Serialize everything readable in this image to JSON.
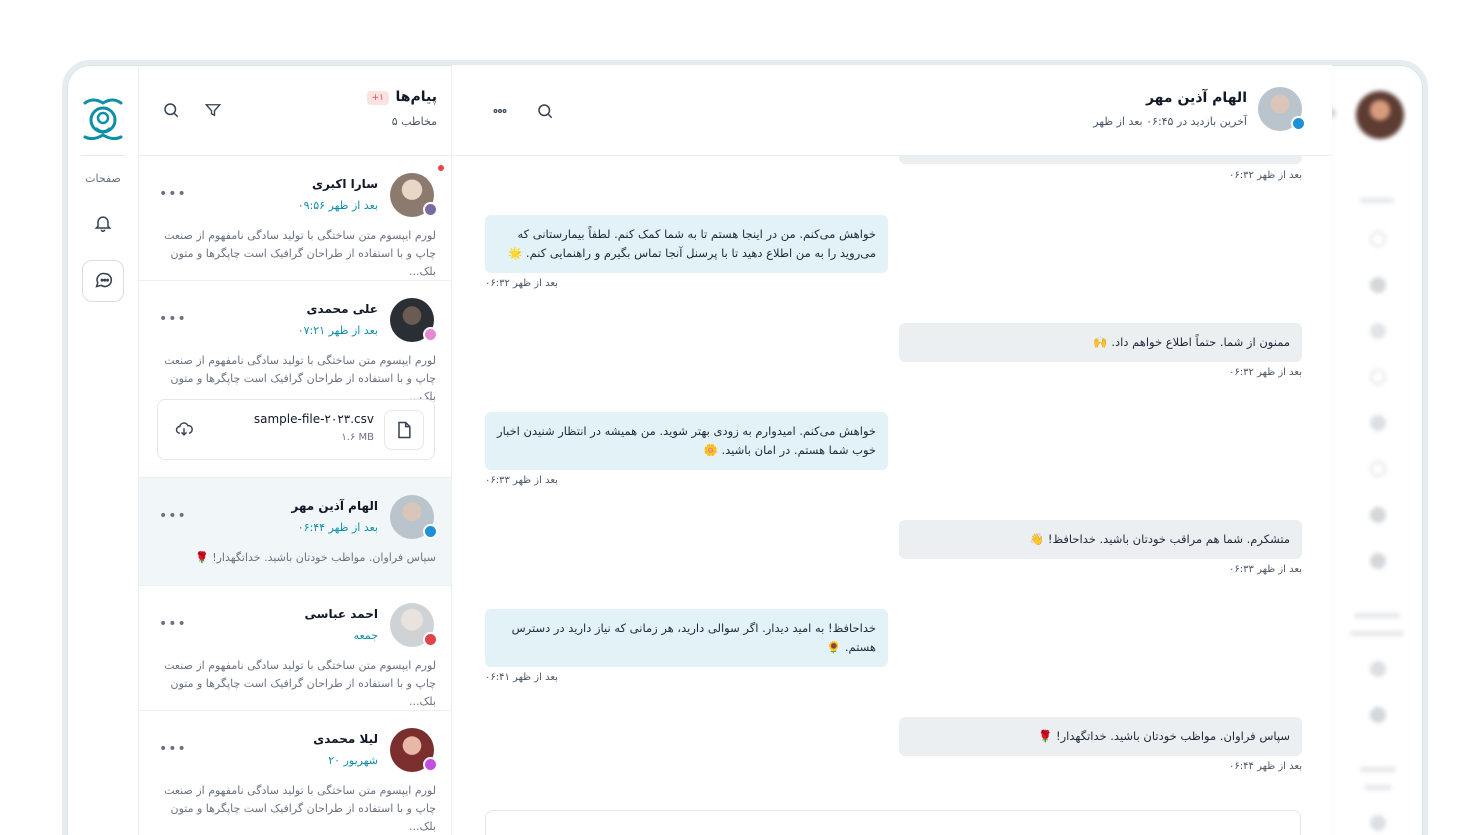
{
  "colors": {
    "accent": "#0e8fa8",
    "bubble_in": "#e3f2f6",
    "bubble_out": "#eceff1",
    "unread": "#ef4444"
  },
  "rail": {
    "pages_label": "صفحات"
  },
  "list": {
    "title": "پیام‌ها",
    "badge": "+۱",
    "subtitle": "۵ مخاطب",
    "conversations": [
      {
        "name": "سارا اکبری",
        "time": "۰۹:۵۶ بعد از ظهر",
        "preview": "لورم ایپسوم متن ساختگی با تولید سادگی نامفهوم از صنعت چاپ و با استفاده از طراحان گرافیک است چاپگرها و متون بلک...",
        "status_color": "#7c6a9e",
        "unread": true
      },
      {
        "name": "علی محمدی",
        "time": "۰۷:۲۱ بعد از ظهر",
        "preview": "لورم ایپسوم متن ساختگی با تولید سادگی نامفهوم از صنعت چاپ و با استفاده از طراحان گرافیک است چاپگرها و متون بلک...",
        "status_color": "#e38ad0",
        "file": {
          "name": "sample-file-۲۰۲۳.csv",
          "size": "۱.۶ MB"
        }
      },
      {
        "name": "الهام آذین مهر",
        "time": "۰۶:۴۴ بعد از ظهر",
        "preview": "سپاس فراوان. مواظب خودتان باشید. خداتگهدار! 🌹",
        "status_color": "#1f8fd6",
        "active": true
      },
      {
        "name": "احمد عباسی",
        "time": "جمعه",
        "preview": "لورم ایپسوم متن ساختگی با تولید سادگی نامفهوم از صنعت چاپ و با استفاده از طراحان گرافیک است چاپگرها و متون بلک...",
        "status_color": "#e0434b"
      },
      {
        "name": "لیلا محمدی",
        "time": "۲۰ شهریور",
        "preview": "لورم ایپسوم متن ساختگی با تولید سادگی نامفهوم از صنعت چاپ و با استفاده از طراحان گرافیک است چاپگرها و متون بلک...",
        "status_color": "#c44de0"
      }
    ]
  },
  "chat": {
    "contact_name": "الهام آذین مهر",
    "last_seen": "آخرین بازدید در ۰۶:۴۵ بعد از ظهر",
    "messages": [
      {
        "dir": "out",
        "text": "",
        "time": "۰۶:۳۲ بعد از ظهر"
      },
      {
        "dir": "in",
        "text": "خواهش می‌کنم. من در اینجا هستم تا به شما کمک کنم. لطفاً بیمارستانی که می‌روید را به من اطلاع دهید تا با پرسنل آنجا تماس بگیرم و راهنمایی کنم. 🌟",
        "time": "۰۶:۳۲ بعد از ظهر"
      },
      {
        "dir": "out",
        "text": "ممنون از شما. حتماً اطلاع خواهم داد. 🙌",
        "time": "۰۶:۳۲ بعد از ظهر"
      },
      {
        "dir": "in",
        "text": "خواهش می‌کنم. امیدوارم به زودی بهتر شوید. من همیشه در انتظار شنیدن اخبار خوب شما هستم. در امان باشید. 🌼",
        "time": "۰۶:۳۳ بعد از ظهر"
      },
      {
        "dir": "out",
        "text": "متشکرم. شما هم مراقب خودتان باشید. خداحافظ! 👋",
        "time": "۰۶:۳۳ بعد از ظهر"
      },
      {
        "dir": "in",
        "text": "خداحافظ! به امید دیدار. اگر سوالی دارید، هر زمانی که نیاز دارید در دسترس هستم. 🌻",
        "time": "۰۶:۴۱ بعد از ظهر"
      },
      {
        "dir": "out",
        "text": "سپاس فراوان. مواظب خودتان باشید. خداتگهدار! 🌹",
        "time": "۰۶:۴۴ بعد از ظهر"
      }
    ]
  }
}
